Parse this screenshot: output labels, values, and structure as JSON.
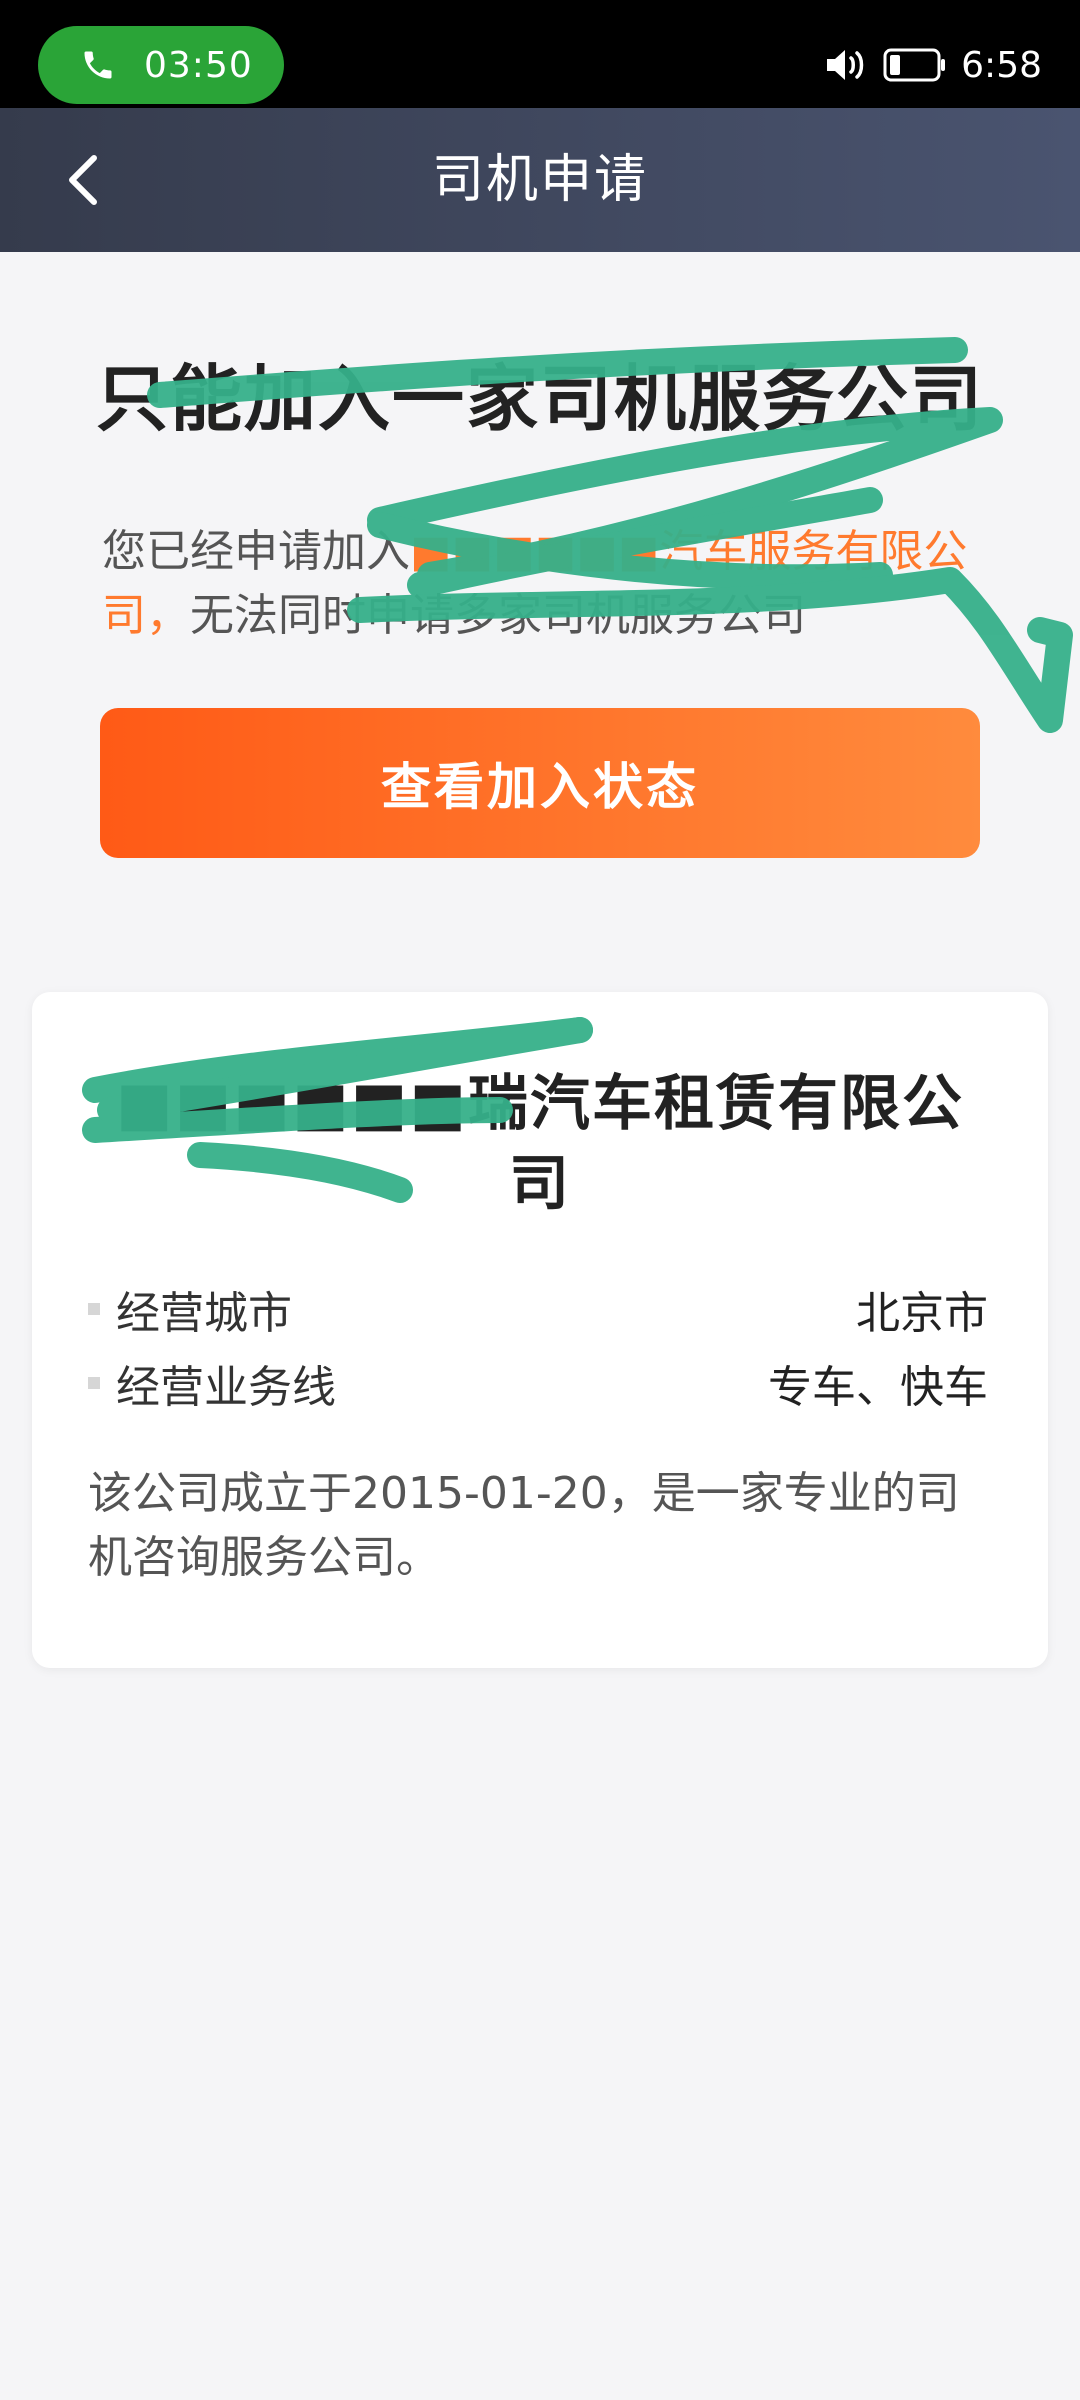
{
  "status_bar": {
    "call_time": "03:50",
    "clock": "6:58"
  },
  "header": {
    "title": "司机申请"
  },
  "main": {
    "title": "只能加入一家司机服务公司",
    "notice_prefix": "您已经申请加入",
    "notice_company": "■■■■■■汽车服务有限公司，",
    "notice_suffix": "无法同时申请多家司机服务公司",
    "status_button": "查看加入状态"
  },
  "card": {
    "title": "■■■■■■瑞汽车租赁有限公司",
    "rows": [
      {
        "label": "经营城市",
        "value": "北京市"
      },
      {
        "label": "经营业务线",
        "value": "专车、快车"
      }
    ],
    "description": "该公司成立于2015-01-20，是一家专业的司机咨询服务公司。"
  },
  "colors": {
    "accent": "#ff6a22",
    "header": "#3d4459",
    "call_green": "#2aa437",
    "scribble": "#36b08a"
  }
}
